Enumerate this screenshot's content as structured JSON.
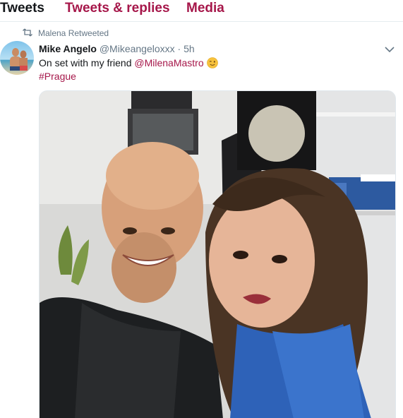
{
  "tabs": [
    {
      "label": "Tweets",
      "active": true
    },
    {
      "label": "Tweets & replies",
      "active": false
    },
    {
      "label": "Media",
      "active": false
    }
  ],
  "tweet": {
    "retweet_context": "Malena Retweeted",
    "author": {
      "fullname": "Mike Angelo",
      "screen_name": "@Mikeangeloxxx",
      "separator": "·",
      "time": "5h"
    },
    "text": {
      "prefix": "On set with my friend ",
      "mention": "@MilenaMastro",
      "emoji": "winking-face",
      "hashtag": "#Prague"
    },
    "media": {
      "type": "photo",
      "subject": "selfie-two-people"
    }
  },
  "colors": {
    "accent": "#a6174a",
    "text_primary": "#14171a",
    "text_secondary": "#657786",
    "divider": "#e6ecf0"
  }
}
